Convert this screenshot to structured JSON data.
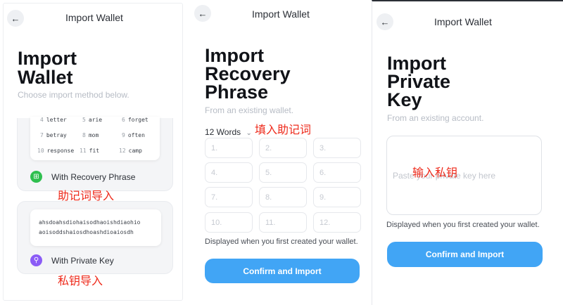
{
  "panel1": {
    "header": "Import Wallet",
    "title_line1": "Import",
    "title_line2": "Wallet",
    "subtitle": "Choose import method below.",
    "words": [
      {
        "n": "4",
        "w": "letter"
      },
      {
        "n": "5",
        "w": "arie"
      },
      {
        "n": "6",
        "w": "forget"
      },
      {
        "n": "7",
        "w": "betray"
      },
      {
        "n": "8",
        "w": "mom"
      },
      {
        "n": "9",
        "w": "often"
      },
      {
        "n": "10",
        "w": "response"
      },
      {
        "n": "11",
        "w": "fit"
      },
      {
        "n": "12",
        "w": "camp"
      }
    ],
    "recovery_label": "With Recovery Phrase",
    "recovery_annotation": "助记词导入",
    "private_key_sample_line1": "ahsdoahsdiohaisodhaoishdiaohio",
    "private_key_sample_line2": "aoisoddshaiosdhoashdioaiosdh",
    "private_key_label": "With Private Key",
    "private_key_annotation": "私钥导入"
  },
  "panel2": {
    "header": "Import Wallet",
    "title_line1": "Import",
    "title_line2": "Recovery",
    "title_line3": "Phrase",
    "subtitle": "From an existing wallet.",
    "word_count": "12 Words",
    "annotation": "填入助记词",
    "cells": [
      "1.",
      "2.",
      "3.",
      "4.",
      "5.",
      "6.",
      "7.",
      "8.",
      "9.",
      "10.",
      "11.",
      "12."
    ],
    "note": "Displayed when you first created your wallet.",
    "button": "Confirm and Import"
  },
  "panel3": {
    "header": "Import Wallet",
    "title_line1": "Import",
    "title_line2": "Private",
    "title_line3": "Key",
    "subtitle": "From an existing account.",
    "placeholder": "Paste your private key here",
    "annotation": "输入私钥",
    "note": "Displayed when you first created your wallet.",
    "button": "Confirm and Import"
  },
  "icons": {
    "back": "arrow-left-icon",
    "recovery": "grid-icon",
    "private_key": "key-icon",
    "dropdown": "chevron-down-icon"
  },
  "colors": {
    "accent": "#41a5f5",
    "recovery_icon": "#2fbf4f",
    "key_icon": "#8b5cf6",
    "annotation": "#ee2a1b"
  }
}
